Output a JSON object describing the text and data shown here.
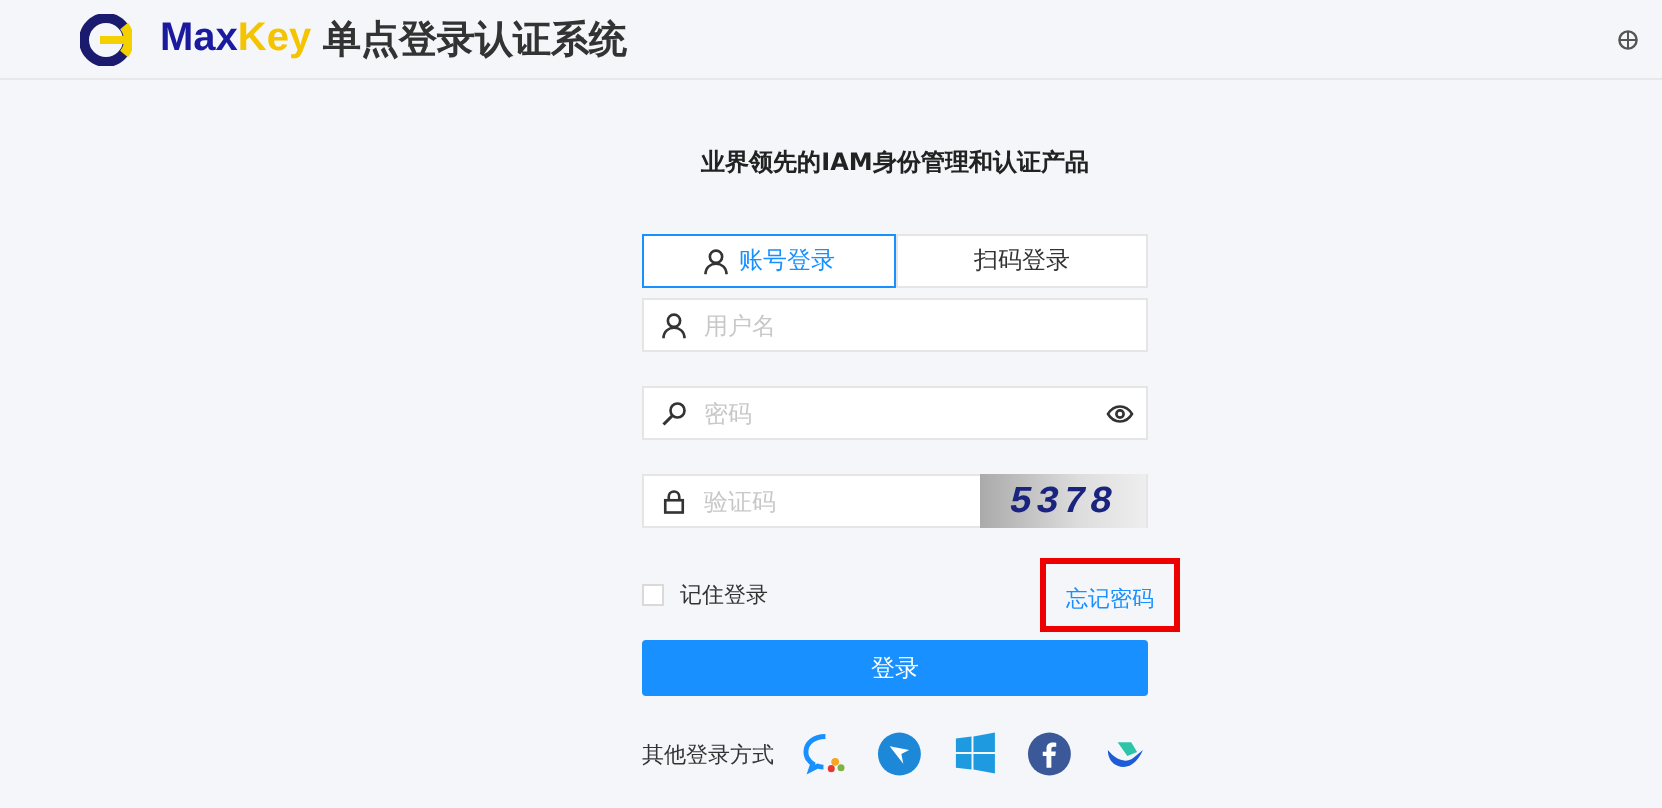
{
  "header": {
    "brand_part1": "Max",
    "brand_part2": "Key",
    "title": "单点登录认证系统"
  },
  "tagline": "业界领先的IAM身份管理和认证产品",
  "tabs": [
    {
      "label": "账号登录",
      "selected": true,
      "kind": "account"
    },
    {
      "label": "扫码登录",
      "selected": false,
      "kind": "scan"
    }
  ],
  "fields": [
    {
      "kind": "user",
      "placeholder": "用户名"
    },
    {
      "kind": "password",
      "placeholder": "密码"
    },
    {
      "kind": "captcha",
      "placeholder": "验证码",
      "captcha": "5378"
    }
  ],
  "remember": {
    "label": "记住登录",
    "checked": false
  },
  "forgot_link": {
    "label": "忘记密码",
    "highlighted": true
  },
  "login_button": "登录",
  "other_login": {
    "label": "其他登录方式",
    "providers": [
      {
        "kind": "wechat-work"
      },
      {
        "kind": "dingtalk"
      },
      {
        "kind": "windows"
      },
      {
        "kind": "facebook"
      },
      {
        "kind": "feishu"
      }
    ]
  }
}
